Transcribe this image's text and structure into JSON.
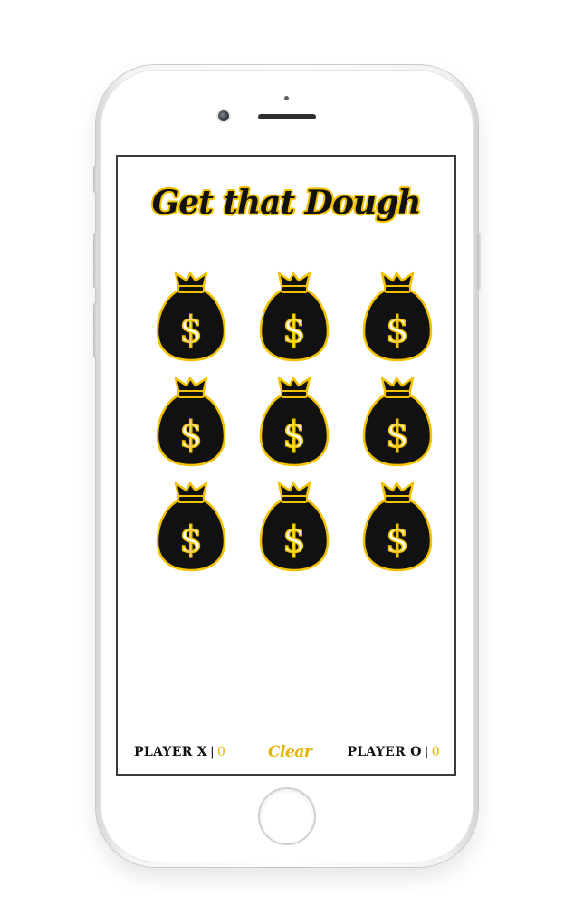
{
  "app": {
    "title": "Get that Dough"
  },
  "board": {
    "cells": [
      {
        "symbol": "$",
        "icon": "money-bag-icon"
      },
      {
        "symbol": "$",
        "icon": "money-bag-icon"
      },
      {
        "symbol": "$",
        "icon": "money-bag-icon"
      },
      {
        "symbol": "$",
        "icon": "money-bag-icon"
      },
      {
        "symbol": "$",
        "icon": "money-bag-icon"
      },
      {
        "symbol": "$",
        "icon": "money-bag-icon"
      },
      {
        "symbol": "$",
        "icon": "money-bag-icon"
      },
      {
        "symbol": "$",
        "icon": "money-bag-icon"
      },
      {
        "symbol": "$",
        "icon": "money-bag-icon"
      }
    ]
  },
  "footer": {
    "player_x": {
      "label": "PLAYER X",
      "separator": "|",
      "score": "0"
    },
    "clear_label": "Clear",
    "player_o": {
      "label": "PLAYER O",
      "separator": "|",
      "score": "0"
    }
  },
  "colors": {
    "accent_gold": "#f2c200",
    "bag_black": "#111111",
    "text_dark": "#111111"
  }
}
